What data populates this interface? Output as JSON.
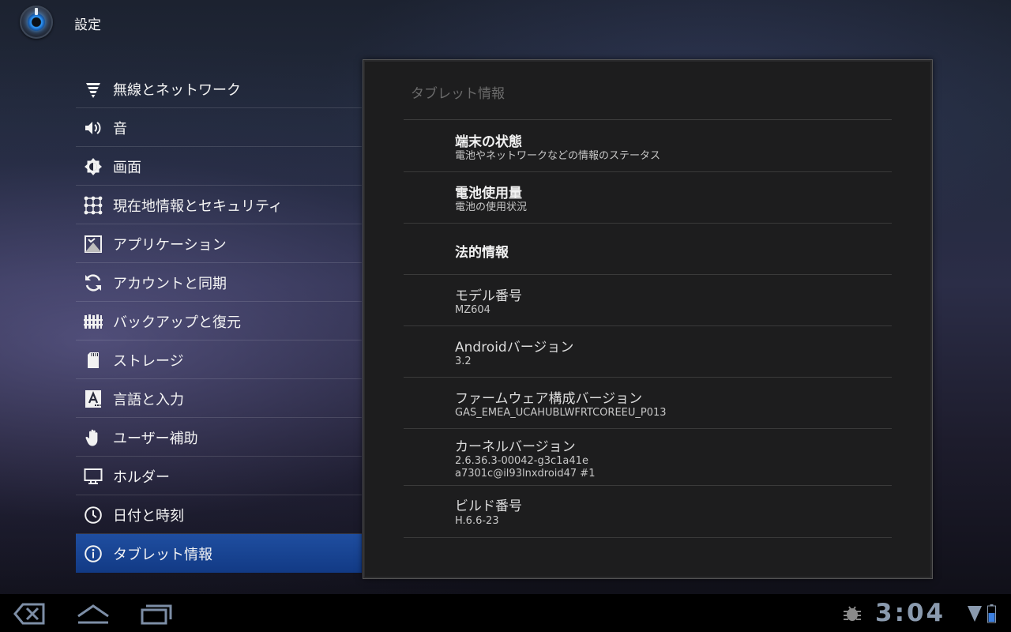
{
  "action_bar": {
    "title": "設定",
    "app_icon": "settings-app-icon"
  },
  "categories": [
    {
      "label": "無線とネットワーク",
      "icon": "wifi-icon"
    },
    {
      "label": "音",
      "icon": "volume-icon"
    },
    {
      "label": "画面",
      "icon": "brightness-icon"
    },
    {
      "label": "現在地情報とセキュリティ",
      "icon": "location-security-icon"
    },
    {
      "label": "アプリケーション",
      "icon": "applications-icon"
    },
    {
      "label": "アカウントと同期",
      "icon": "sync-icon"
    },
    {
      "label": "バックアップと復元",
      "icon": "backup-icon"
    },
    {
      "label": "ストレージ",
      "icon": "sd-card-icon"
    },
    {
      "label": "言語と入力",
      "icon": "language-icon"
    },
    {
      "label": "ユーザー補助",
      "icon": "accessibility-hand-icon"
    },
    {
      "label": "ホルダー",
      "icon": "dock-monitor-icon"
    },
    {
      "label": "日付と時刻",
      "icon": "clock-icon"
    },
    {
      "label": "タブレット情報",
      "icon": "info-icon",
      "selected": true
    }
  ],
  "panel": {
    "title": "タブレット情報",
    "items": [
      {
        "title": "端末の状態",
        "summary": "電池やネットワークなどの情報のステータス"
      },
      {
        "title": "電池使用量",
        "summary": "電池の使用状況"
      },
      {
        "title": "法的情報"
      },
      {
        "title": "モデル番号",
        "summary": "MZ604"
      },
      {
        "title": "Androidバージョン",
        "summary": "3.2"
      },
      {
        "title": "ファームウェア構成バージョン",
        "summary": "GAS_EMEA_UCAHUBLWFRTCOREEU_P013"
      },
      {
        "title": "カーネルバージョン",
        "summary": "2.6.36.3-00042-g3c1a41e",
        "summary2": "a7301c@il93lnxdroid47 #1"
      },
      {
        "title": "ビルド番号",
        "summary": "H.6.6-23"
      }
    ]
  },
  "system_bar": {
    "clock": "3:04",
    "nav": [
      "back-icon",
      "home-icon",
      "recent-apps-icon"
    ],
    "status": [
      "usb-debugging-icon",
      "signal-icon",
      "battery-icon"
    ],
    "accent_color": "#8a9aae"
  },
  "colors": {
    "selected_item": "#1a4595",
    "panel_background": "#1d1d1e"
  }
}
